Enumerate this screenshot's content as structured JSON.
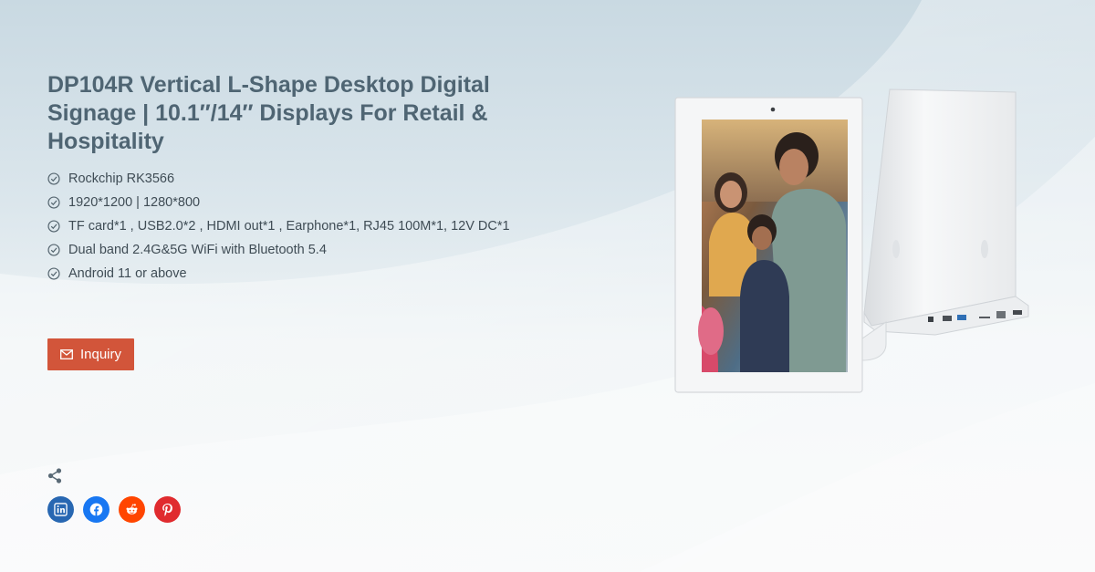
{
  "product": {
    "title": "DP104R Vertical L-Shape Desktop Digital Signage | 10.1″/14″ Displays For Retail & Hospitality",
    "features": [
      "Rockchip RK3566",
      "1920*1200 | 1280*800",
      "TF card*1 , USB2.0*2 , HDMI out*1 , Earphone*1, RJ45 100M*1, 12V DC*1",
      "Dual band 2.4G&5G WiFi with Bluetooth 5.4",
      "Android 11 or above"
    ]
  },
  "actions": {
    "inquiry_label": "Inquiry"
  },
  "share": {
    "icon": "share-icon",
    "networks": [
      {
        "name": "linkedin",
        "icon": "linkedin-icon",
        "color": "#2867b2"
      },
      {
        "name": "facebook",
        "icon": "facebook-icon",
        "color": "#1877f2"
      },
      {
        "name": "reddit",
        "icon": "reddit-icon",
        "color": "#ff4500"
      },
      {
        "name": "pinterest",
        "icon": "pinterest-icon",
        "color": "#e02b2f"
      }
    ]
  },
  "colors": {
    "accent": "#d2553a",
    "title": "#4f6573",
    "text": "#3f4c55"
  }
}
